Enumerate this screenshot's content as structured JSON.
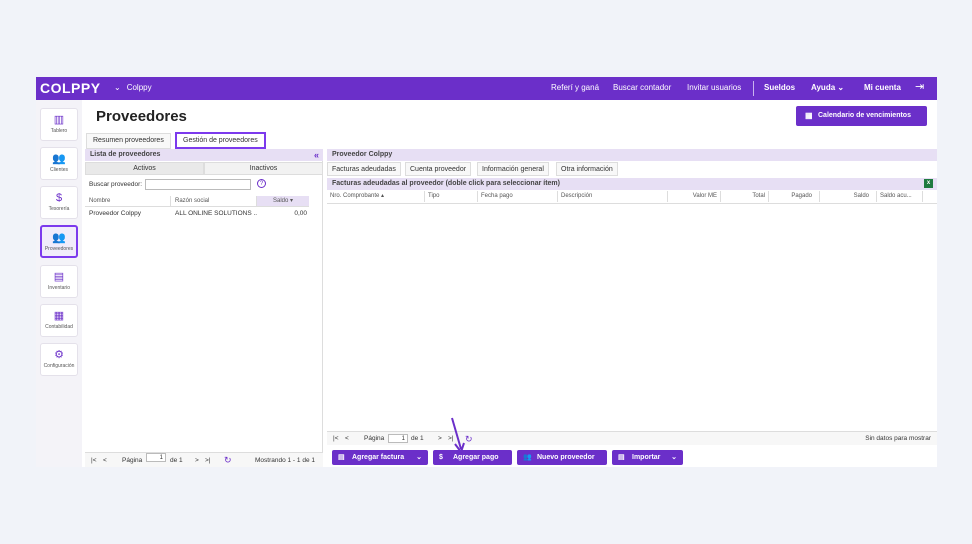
{
  "topbar": {
    "logo": "COLPPY",
    "company": "Colppy",
    "links": [
      "Referí y ganá",
      "Buscar contador",
      "Invitar usuarios"
    ],
    "sueldos": "Sueldos",
    "ayuda": "Ayuda",
    "mi_cuenta": "Mi cuenta",
    "chevron": "⌄",
    "logout_icon": "⇥"
  },
  "sidebar": {
    "items": [
      {
        "label": "Tablero",
        "icon": "bar-chart-icon",
        "glyph": "▥"
      },
      {
        "label": "Clientes",
        "icon": "people-icon",
        "glyph": "👥"
      },
      {
        "label": "Tesorería",
        "icon": "dollar-icon",
        "glyph": "$"
      },
      {
        "label": "Proveedores",
        "icon": "people-icon",
        "glyph": "👥",
        "active": true
      },
      {
        "label": "Inventario",
        "icon": "archive-icon",
        "glyph": "▤"
      },
      {
        "label": "Contabilidad",
        "icon": "document-icon",
        "glyph": "▦"
      },
      {
        "label": "Configuración",
        "icon": "gear-icon",
        "glyph": "⚙"
      }
    ]
  },
  "page": {
    "title": "Proveedores",
    "calendar_button": "Calendario de vencimientos",
    "tabs": [
      "Resumen proveedores",
      "Gestión de proveedores"
    ]
  },
  "left": {
    "header": "Lista de proveedores",
    "collapse": "«",
    "subtabs": [
      "Activos",
      "Inactivos"
    ],
    "search_label": "Buscar proveedor:",
    "help": "?",
    "columns": [
      "Nombre",
      "Razón social",
      "Saldo ▾"
    ],
    "rows": [
      {
        "nombre": "Proveedor Colppy",
        "razon": "ALL ONLINE SOLUTIONS ...",
        "saldo": "0,00"
      }
    ],
    "pager": {
      "first": "|<",
      "prev": "<",
      "page_label": "Página",
      "page": "1",
      "of": "de 1",
      "next": ">",
      "last": ">|",
      "refresh": "↻",
      "status": "Mostrando 1 - 1 de 1"
    }
  },
  "right": {
    "header": "Proveedor Colppy",
    "tabs": [
      "Facturas adeudadas",
      "Cuenta proveedor",
      "Información general",
      "Otra información"
    ],
    "subheader": "Facturas adeudadas al proveedor (doble click para seleccionar ítem)",
    "xls": "x",
    "columns": [
      "Nro. Comprobante ▴",
      "Tipo",
      "Fecha pago",
      "Descripción",
      "Valor ME",
      "Total",
      "Pagado",
      "Saldo",
      "Saldo acu..."
    ],
    "pager": {
      "first": "|<",
      "prev": "<",
      "page_label": "Página",
      "page": "1",
      "of": "de 1",
      "next": ">",
      "last": ">|",
      "refresh": "↻",
      "status": "Sin datos para mostrar"
    }
  },
  "actions": [
    {
      "label": "Agregar factura",
      "glyph": "▤",
      "dropdown": "⌄"
    },
    {
      "label": "Agregar pago",
      "glyph": "$",
      "dropdown": ""
    },
    {
      "label": "Nuevo proveedor",
      "glyph": "👥",
      "dropdown": ""
    },
    {
      "label": "Importar",
      "glyph": "▤",
      "dropdown": "⌄"
    }
  ],
  "colors": {
    "brand": "#6b2fc9",
    "highlight": "#7c3aed"
  }
}
